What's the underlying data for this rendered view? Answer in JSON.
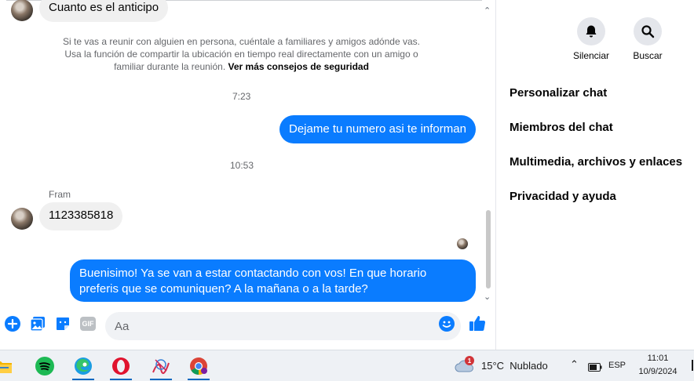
{
  "chat": {
    "first_message": "Cuanto es el anticipo",
    "safety_notice": "Si te vas a reunir con alguien en persona, cuéntale a familiares y amigos adónde vas. Usa la función de compartir la ubicación en tiempo real directamente con un amigo o familiar durante la reunión.",
    "safety_link": "Ver más consejos de seguridad",
    "time_1": "7:23",
    "outgoing_1": "Dejame tu numero asi te informan",
    "time_2": "10:53",
    "sender_name": "Fram",
    "incoming_2": "1123385818",
    "outgoing_2": "Buenisimo! Ya se van a estar contactando con vos! En que horario preferis que se comuniquen? A la mañana o a la tarde?"
  },
  "composer": {
    "placeholder": "Aa",
    "gif_label": "GIF"
  },
  "sidebar": {
    "mute_label": "Silenciar",
    "search_label": "Buscar",
    "items": [
      {
        "label": "Personalizar chat"
      },
      {
        "label": "Miembros del chat"
      },
      {
        "label": "Multimedia, archivos y enlaces"
      },
      {
        "label": "Privacidad y ayuda"
      }
    ]
  },
  "taskbar": {
    "apps": [
      "file-explorer",
      "spotify",
      "edge",
      "opera",
      "paint-tool",
      "chrome"
    ],
    "weather_badge": "1",
    "weather": "15°C  Nublado",
    "lang": "ESP",
    "time": "11:01",
    "date": "10/9/2024"
  },
  "colors": {
    "messenger_blue": "#0a7cff",
    "incoming_bubble": "#f0f0f0"
  }
}
